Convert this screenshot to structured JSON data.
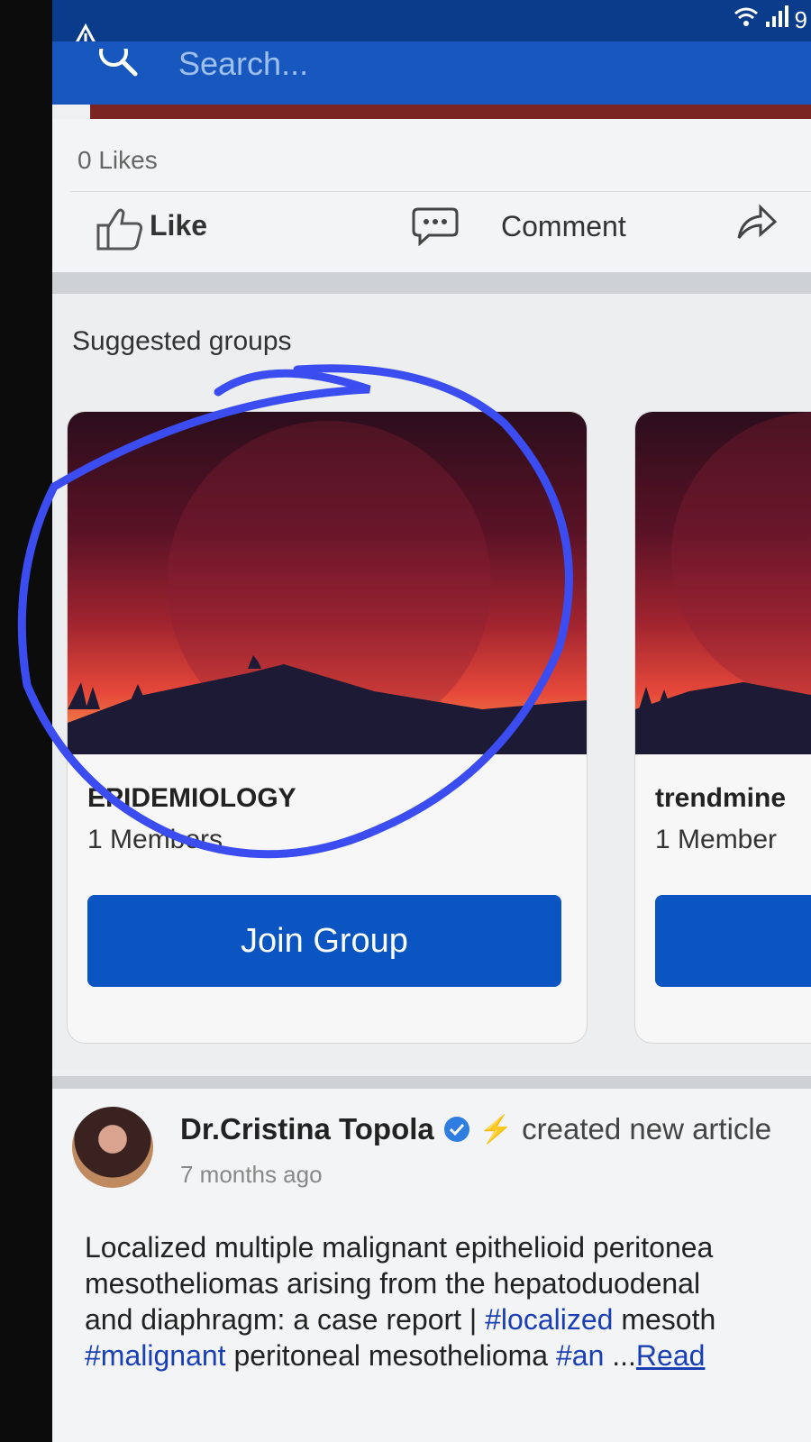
{
  "search": {
    "placeholder": "Search..."
  },
  "status": {
    "battery": "9"
  },
  "post": {
    "likes_count": "0 Likes",
    "like_label": "Like",
    "comment_label": "Comment"
  },
  "suggested_groups": {
    "title": "Suggested groups",
    "groups": [
      {
        "name": "EPIDEMIOLOGY",
        "members": "1 Members",
        "join_label": "Join Group"
      },
      {
        "name": "trendmine",
        "members": "1 Member",
        "join_label": ""
      }
    ]
  },
  "article": {
    "author": "Dr.Cristina Topola",
    "action": "created new article",
    "time": "7 months ago",
    "line1": "Localized multiple malignant epithelioid peritonea",
    "line2": "mesotheliomas arising from the hepatoduodenal",
    "line3_pre": "and diaphragm: a case report | ",
    "tag1": "#localized",
    "line3_post": " mesoth",
    "tag2": "#malignant",
    "line4_mid": " peritoneal mesothelioma ",
    "tag3": "#an",
    "ellipsis": " ...",
    "read_more": "Read"
  },
  "colors": {
    "header": "#0b3c8c",
    "topbar": "#1857bd",
    "button": "#0a55c2",
    "annotation": "#3b4df0"
  }
}
